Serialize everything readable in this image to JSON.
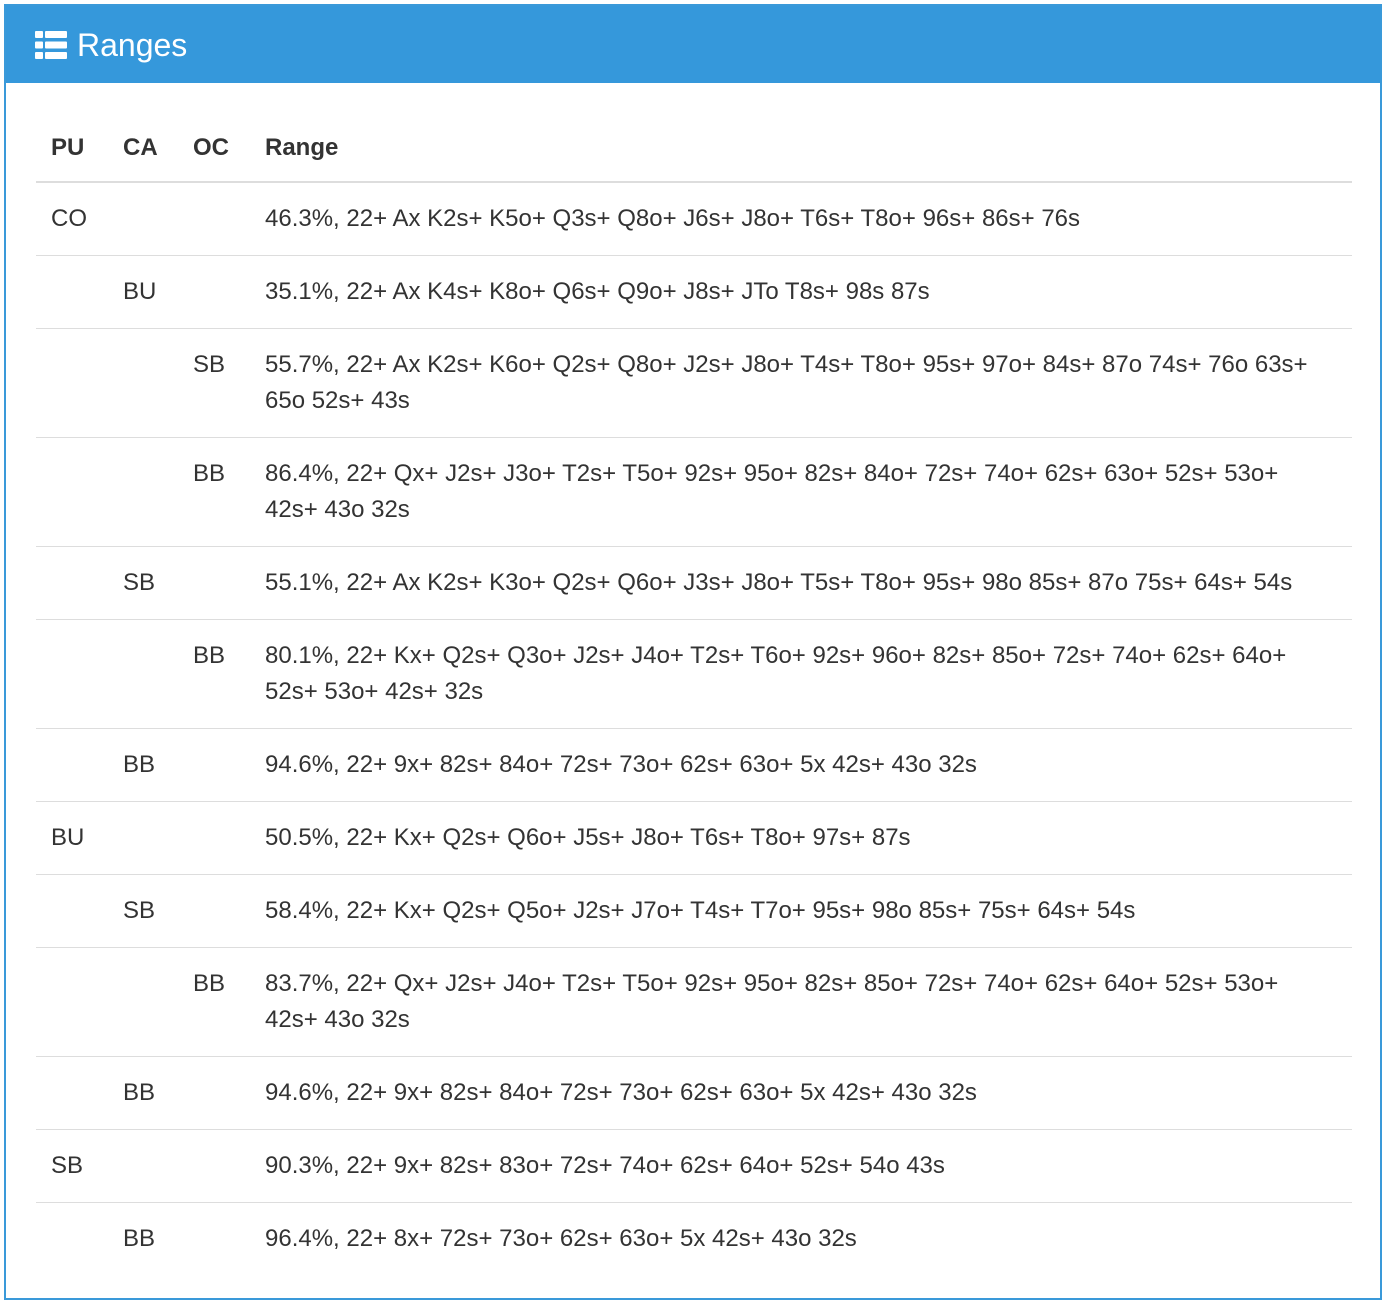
{
  "panel": {
    "title": "Ranges",
    "icon": "list-icon",
    "accent_color": "#3598db"
  },
  "table": {
    "headers": {
      "pu": "PU",
      "ca": "CA",
      "oc": "OC",
      "range": "Range"
    },
    "rows": [
      {
        "pu": "CO",
        "ca": "",
        "oc": "",
        "range": "46.3%, 22+ Ax K2s+ K5o+ Q3s+ Q8o+ J6s+ J8o+ T6s+ T8o+ 96s+ 86s+ 76s"
      },
      {
        "pu": "",
        "ca": "BU",
        "oc": "",
        "range": "35.1%, 22+ Ax K4s+ K8o+ Q6s+ Q9o+ J8s+ JTo T8s+ 98s 87s"
      },
      {
        "pu": "",
        "ca": "",
        "oc": "SB",
        "range": "55.7%, 22+ Ax K2s+ K6o+ Q2s+ Q8o+ J2s+ J8o+ T4s+ T8o+ 95s+ 97o+ 84s+ 87o 74s+ 76o 63s+ 65o 52s+ 43s"
      },
      {
        "pu": "",
        "ca": "",
        "oc": "BB",
        "range": "86.4%, 22+ Qx+ J2s+ J3o+ T2s+ T5o+ 92s+ 95o+ 82s+ 84o+ 72s+ 74o+ 62s+ 63o+ 52s+ 53o+ 42s+ 43o 32s"
      },
      {
        "pu": "",
        "ca": "SB",
        "oc": "",
        "range": "55.1%, 22+ Ax K2s+ K3o+ Q2s+ Q6o+ J3s+ J8o+ T5s+ T8o+ 95s+ 98o 85s+ 87o 75s+ 64s+ 54s"
      },
      {
        "pu": "",
        "ca": "",
        "oc": "BB",
        "range": "80.1%, 22+ Kx+ Q2s+ Q3o+ J2s+ J4o+ T2s+ T6o+ 92s+ 96o+ 82s+ 85o+ 72s+ 74o+ 62s+ 64o+ 52s+ 53o+ 42s+ 32s"
      },
      {
        "pu": "",
        "ca": "BB",
        "oc": "",
        "range": "94.6%, 22+ 9x+ 82s+ 84o+ 72s+ 73o+ 62s+ 63o+ 5x 42s+ 43o 32s"
      },
      {
        "pu": "BU",
        "ca": "",
        "oc": "",
        "range": "50.5%, 22+ Kx+ Q2s+ Q6o+ J5s+ J8o+ T6s+ T8o+ 97s+ 87s"
      },
      {
        "pu": "",
        "ca": "SB",
        "oc": "",
        "range": "58.4%, 22+ Kx+ Q2s+ Q5o+ J2s+ J7o+ T4s+ T7o+ 95s+ 98o 85s+ 75s+ 64s+ 54s"
      },
      {
        "pu": "",
        "ca": "",
        "oc": "BB",
        "range": "83.7%, 22+ Qx+ J2s+ J4o+ T2s+ T5o+ 92s+ 95o+ 82s+ 85o+ 72s+ 74o+ 62s+ 64o+ 52s+ 53o+ 42s+ 43o 32s"
      },
      {
        "pu": "",
        "ca": "BB",
        "oc": "",
        "range": "94.6%, 22+ 9x+ 82s+ 84o+ 72s+ 73o+ 62s+ 63o+ 5x 42s+ 43o 32s"
      },
      {
        "pu": "SB",
        "ca": "",
        "oc": "",
        "range": "90.3%, 22+ 9x+ 82s+ 83o+ 72s+ 74o+ 62s+ 64o+ 52s+ 54o 43s"
      },
      {
        "pu": "",
        "ca": "BB",
        "oc": "",
        "range": "96.4%, 22+ 8x+ 72s+ 73o+ 62s+ 63o+ 5x 42s+ 43o 32s"
      }
    ]
  }
}
